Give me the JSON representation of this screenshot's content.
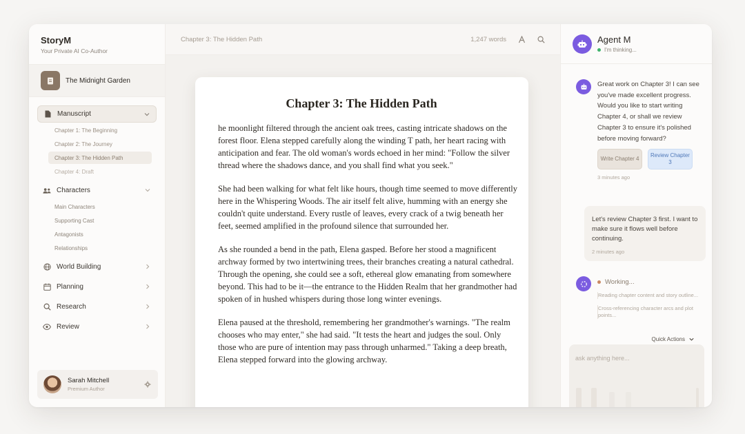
{
  "brand": {
    "title": "StoryM",
    "subtitle": "Your Private AI Co-Author"
  },
  "project": {
    "name": "The Midnight Garden",
    "icon": "document-icon"
  },
  "nav": {
    "manuscript": {
      "label": "Manuscript",
      "chapters": [
        "Chapter 1: The Beginning",
        "Chapter 2: The Journey",
        "Chapter 3: The Hidden Path",
        "Chapter 4: Draft"
      ]
    },
    "characters": {
      "label": "Characters",
      "items": [
        "Main Characters",
        "Supporting Cast",
        "Antagonists",
        "Relationships"
      ]
    },
    "world_building": "World Building",
    "planning": "Planning",
    "research": "Research",
    "review": "Review"
  },
  "user": {
    "name": "Sarah Mitchell",
    "role": "Premium Author"
  },
  "topbar": {
    "breadcrumb": "Chapter 3: The Hidden Path",
    "word_count": "1,247 words"
  },
  "document": {
    "title": "Chapter 3: The Hidden Path",
    "paragraphs": [
      "he moonlight filtered through the ancient oak trees, casting intricate shadows on the forest floor. Elena stepped carefully along the winding T path, her heart racing with anticipation and fear. The old woman's words echoed in her mind: \"Follow the silver thread where the shadows dance, and you shall find what you seek.\"",
      "She had been walking for what felt like hours, though time seemed to move differently here in the Whispering Woods. The air itself felt alive, humming with an energy she couldn't quite understand. Every rustle of leaves, every crack of a twig beneath her feet, seemed amplified in the profound silence that surrounded her.",
      "As she rounded a bend in the path, Elena gasped. Before her stood a magnificent archway formed by two intertwining trees, their branches creating a natural cathedral. Through the opening, she could see a soft, ethereal glow emanating from somewhere beyond. This had to be it—the entrance to the Hidden Realm that her grandmother had spoken of in hushed whispers during those long winter evenings.",
      "Elena paused at the threshold, remembering her grandmother's warnings. \"The realm chooses who may enter,\" she had said. \"It tests the heart and judges the soul. Only those who are pure of intention may pass through unharmed.\" Taking a deep breath, Elena stepped forward into the glowing archway."
    ]
  },
  "chat": {
    "agent_name": "Agent M",
    "agent_status": "I'm thinking...",
    "agent_message": "Great work on Chapter 3! I can see you've made excellent progress. Would you like to start writing Chapter 4, or shall we review Chapter 3 to ensure it's polished before moving forward?",
    "choice_write": "Write Chapter 4",
    "choice_review": "Review Chapter 3",
    "agent_time": "3 minutes ago",
    "user_message": "Let's review Chapter 3 first. I want to make sure it flows well before continuing.",
    "user_time": "2 minutes ago",
    "working_label": "Working...",
    "working_steps": [
      "Reading chapter content and story outline...",
      "Cross-referencing character arcs and plot points..."
    ],
    "quick_actions": "Quick Actions",
    "input_placeholder": "ask anything here..."
  },
  "colors": {
    "accent_purple": "#7b5ce0",
    "status_green": "#3fb36b",
    "working_orange": "#c98a64",
    "review_blue": "#4f78b8"
  }
}
